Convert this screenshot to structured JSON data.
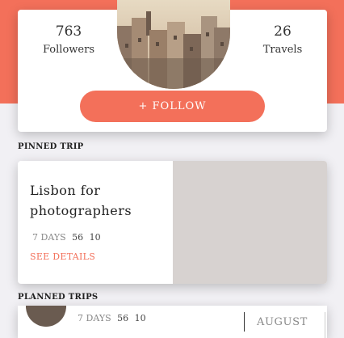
{
  "profile": {
    "followers": {
      "count": "763",
      "label": "Followers"
    },
    "travels": {
      "count": "26",
      "label": "Travels"
    },
    "follow_button_label": "+ FOLLOW",
    "accent_color": "#f3705a"
  },
  "pinned": {
    "section_label": "PINNED TRIP",
    "title": "Lisbon for photographers",
    "days_label": "7 DAYS",
    "stat_1": "56",
    "stat_2": "10",
    "link_label": "SEE DETAILS"
  },
  "planned": {
    "section_label": "PLANNED TRIPS",
    "items": [
      {
        "days_label": "7 DAYS",
        "stat_1": "56",
        "stat_2": "10",
        "month": "AUGUST"
      }
    ]
  }
}
